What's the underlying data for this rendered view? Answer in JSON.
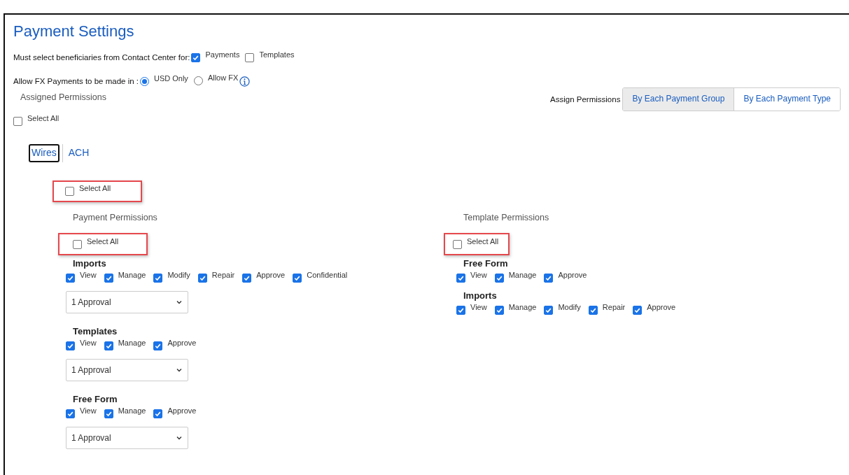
{
  "title": "Payment Settings",
  "beneficiary_setting": {
    "label": "Must select beneficiaries from Contact Center for:",
    "options": [
      {
        "label": "Payments",
        "checked": true
      },
      {
        "label": "Templates",
        "checked": false
      }
    ]
  },
  "fx_setting": {
    "label": "Allow FX Payments to be made in :",
    "options": [
      {
        "label": "USD Only",
        "selected": true,
        "info": false
      },
      {
        "label": "Allow FX",
        "selected": false,
        "info": true
      }
    ]
  },
  "assigned_permissions": {
    "heading": "Assigned Permissions",
    "select_all": {
      "label": "Select All",
      "checked": false
    }
  },
  "assign_mode": {
    "label": "Assign Permissions",
    "options": [
      {
        "label": "By Each Payment Group",
        "selected": true
      },
      {
        "label": "By Each Payment Type",
        "selected": false
      }
    ]
  },
  "tabs": [
    {
      "label": "Wires",
      "selected": true
    },
    {
      "label": "ACH",
      "selected": false
    }
  ],
  "group_select_all": {
    "label": "Select All",
    "checked": false,
    "highlighted": true
  },
  "payment_permissions": {
    "heading": "Payment Permissions",
    "select_all": {
      "label": "Select All",
      "checked": false,
      "highlighted": true
    },
    "groups": [
      {
        "name": "Imports",
        "permissions": [
          {
            "label": "View",
            "checked": true
          },
          {
            "label": "Manage",
            "checked": true
          },
          {
            "label": "Modify",
            "checked": true
          },
          {
            "label": "Repair",
            "checked": true
          },
          {
            "label": "Approve",
            "checked": true
          },
          {
            "label": "Confidential",
            "checked": true
          }
        ],
        "approval": "1 Approval"
      },
      {
        "name": "Templates",
        "permissions": [
          {
            "label": "View",
            "checked": true
          },
          {
            "label": "Manage",
            "checked": true
          },
          {
            "label": "Approve",
            "checked": true
          }
        ],
        "approval": "1 Approval"
      },
      {
        "name": "Free Form",
        "permissions": [
          {
            "label": "View",
            "checked": true
          },
          {
            "label": "Manage",
            "checked": true
          },
          {
            "label": "Approve",
            "checked": true
          }
        ],
        "approval": "1 Approval"
      }
    ]
  },
  "template_permissions": {
    "heading": "Template Permissions",
    "select_all": {
      "label": "Select All",
      "checked": false,
      "highlighted": true
    },
    "groups": [
      {
        "name": "Free Form",
        "permissions": [
          {
            "label": "View",
            "checked": true
          },
          {
            "label": "Manage",
            "checked": true
          },
          {
            "label": "Approve",
            "checked": true
          }
        ]
      },
      {
        "name": "Imports",
        "permissions": [
          {
            "label": "View",
            "checked": true
          },
          {
            "label": "Manage",
            "checked": true
          },
          {
            "label": "Modify",
            "checked": true
          },
          {
            "label": "Repair",
            "checked": true
          },
          {
            "label": "Approve",
            "checked": true
          }
        ]
      }
    ]
  }
}
